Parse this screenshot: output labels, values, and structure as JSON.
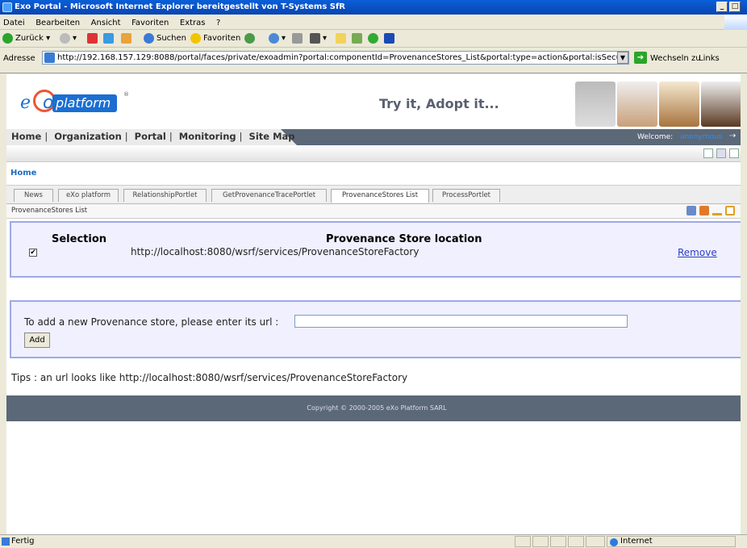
{
  "window": {
    "title": "Exo Portal - Microsoft Internet Explorer bereitgestellt von T-Systems SfR",
    "min_glyph": "_",
    "max_glyph": "□",
    "close_glyph": "✕"
  },
  "menu": {
    "items": [
      "Datei",
      "Bearbeiten",
      "Ansicht",
      "Favoriten",
      "Extras",
      "?"
    ]
  },
  "toolbar": {
    "back_label": "Zurück",
    "search_label": "Suchen",
    "favorites_label": "Favoriten"
  },
  "address": {
    "label": "Adresse",
    "url": "http://192.168.157.129:8088/portal/faces/private/exoadmin?portal:componentId=ProvenanceStores_List&portal:type=action&portal:isSecure=false&delet",
    "go_label": "Wechseln zu",
    "links_label": "Links"
  },
  "portal": {
    "logo": {
      "e": "e",
      "o": "o",
      "platform": "platform",
      "reg": "®"
    },
    "slogan": "Try it, Adopt it...",
    "nav": [
      "Home",
      "Organization",
      "Portal",
      "Monitoring",
      "Site Map"
    ],
    "nav_sep": "|",
    "welcome": "Welcome:",
    "welcome_user": "anonymous",
    "breadcrumb": "Home",
    "tabs": [
      "News",
      "eXo platform",
      "RelationshipPortlet",
      "GetProvenanceTracePortlet",
      "ProvenanceStores List",
      "ProcessPortlet"
    ],
    "active_tab": "ProvenanceStores List",
    "portlet_title": "ProvenanceStores List"
  },
  "stores": {
    "selection_header": "Selection",
    "location_header": "Provenance Store location",
    "rows": [
      {
        "checked": "✔",
        "url": "http://localhost:8080/wsrf/services/ProvenanceStoreFactory",
        "action": "Remove"
      }
    ]
  },
  "add_form": {
    "label": "To add a new Provenance store, please enter its url :",
    "value": "",
    "button": "Add"
  },
  "tips": "Tips : an url looks like http://localhost:8080/wsrf/services/ProvenanceStoreFactory",
  "footer": "Copyright © 2000-2005 eXo Platform SARL",
  "statusbar": {
    "text": "Fertig",
    "zone": "Internet"
  },
  "colors": {
    "accent": "#1a6fd1",
    "nav_bg": "#5b6878",
    "box_bg": "#f0f0ff",
    "box_border": "#9fa8e8",
    "link": "#2b3fc4"
  }
}
